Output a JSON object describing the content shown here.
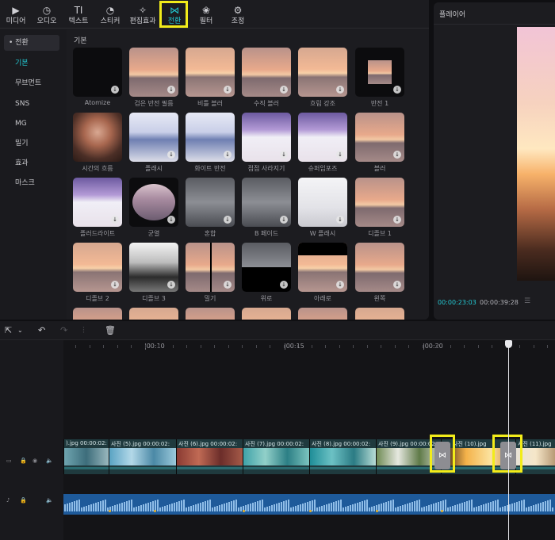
{
  "toolbar": {
    "tools": [
      {
        "id": "media",
        "label": "미디어",
        "icon": "media-icon",
        "glyph": "▶"
      },
      {
        "id": "audio",
        "label": "오디오",
        "icon": "audio-icon",
        "glyph": "◷"
      },
      {
        "id": "text",
        "label": "텍스트",
        "icon": "text-icon",
        "glyph": "TI"
      },
      {
        "id": "sticker",
        "label": "스티커",
        "icon": "sticker-icon",
        "glyph": "◔"
      },
      {
        "id": "effects",
        "label": "편집효과",
        "icon": "effects-icon",
        "glyph": "✧"
      },
      {
        "id": "transition",
        "label": "전환",
        "icon": "transition-icon",
        "glyph": "⋈"
      },
      {
        "id": "filter",
        "label": "필터",
        "icon": "filter-icon",
        "glyph": "❀"
      },
      {
        "id": "adjust",
        "label": "조정",
        "icon": "adjust-icon",
        "glyph": "⚙"
      }
    ],
    "active": "transition"
  },
  "sidebar": {
    "header": "• 전환",
    "items": [
      "기본",
      "무브먼트",
      "SNS",
      "MG",
      "밀기",
      "효과",
      "마스크"
    ],
    "selected": "기본"
  },
  "grid": {
    "section_title": "기본",
    "items": [
      {
        "label": "Atomize",
        "style": "dark"
      },
      {
        "label": "검은 반전 필름",
        "style": "sunset"
      },
      {
        "label": "비틀 블러",
        "style": "sunset2"
      },
      {
        "label": "수직 블러",
        "style": "sunset"
      },
      {
        "label": "흐림 강조",
        "style": "sunset2"
      },
      {
        "label": "반전 1",
        "style": "dark-center"
      },
      {
        "label": "시간의 흐름",
        "style": "portrait"
      },
      {
        "label": "플래시",
        "style": "beach-blue"
      },
      {
        "label": "화이트 반전",
        "style": "beach-blue"
      },
      {
        "label": "점점 사라지기",
        "style": "beach-purple"
      },
      {
        "label": "슈퍼임포즈",
        "style": "beach-purple"
      },
      {
        "label": "블러",
        "style": "sunset"
      },
      {
        "label": "플러드라이트",
        "style": "beach-purple"
      },
      {
        "label": "균열",
        "style": "oval"
      },
      {
        "label": "혼합",
        "style": "grey"
      },
      {
        "label": "B 페이드",
        "style": "grey"
      },
      {
        "label": "W 플래시",
        "style": "white"
      },
      {
        "label": "디졸브 1",
        "style": "sunset"
      },
      {
        "label": "디졸브 2",
        "style": "sunset2"
      },
      {
        "label": "디졸브 3",
        "style": "bw"
      },
      {
        "label": "밀기",
        "style": "split"
      },
      {
        "label": "위로",
        "style": "half-bottom"
      },
      {
        "label": "아래로",
        "style": "half-top"
      },
      {
        "label": "왼쪽",
        "style": "sunset"
      },
      {
        "label": "",
        "style": "sunset"
      },
      {
        "label": "",
        "style": "sunset2"
      },
      {
        "label": "",
        "style": "sunset"
      },
      {
        "label": "",
        "style": "sunset2"
      },
      {
        "label": "",
        "style": "sunset"
      },
      {
        "label": "",
        "style": "sunset2"
      }
    ]
  },
  "player": {
    "title": "플레이어",
    "time_current": "00:00:23:03",
    "time_total": "00:00:39:28"
  },
  "timeline": {
    "ruler_labels": [
      "|00:10",
      "|00:15",
      "|00:20"
    ],
    "clips": [
      {
        "label": ").jpg 00:00:02:"
      },
      {
        "label": "사진 (5).jpg 00:00:02:"
      },
      {
        "label": "사진 (6).jpg 00:00:02:"
      },
      {
        "label": "사진 (7).jpg 00:00:02:"
      },
      {
        "label": "사진 (8).jpg 00:00:02:"
      },
      {
        "label": "사진 (9).jpg 00:00:02:"
      },
      {
        "label": "사진 (10).jpg"
      },
      {
        "label": "사진 (11).jpg"
      }
    ],
    "transition_glyph": "⋈",
    "playhead_position_pct": 90.5
  },
  "colors": {
    "accent": "#23c8d2",
    "highlight": "#f2ec1a",
    "audio_track": "#1e5a9a",
    "video_track": "#1f3a3e"
  }
}
